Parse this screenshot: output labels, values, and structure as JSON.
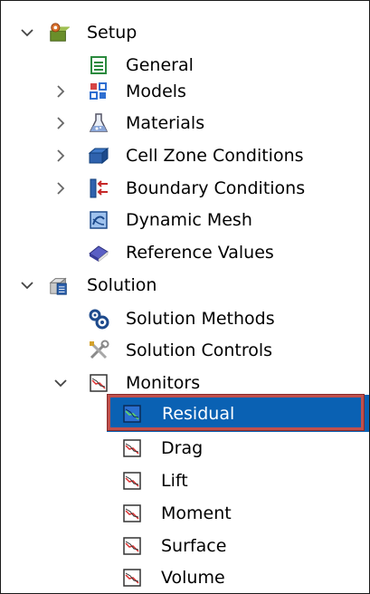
{
  "tree": {
    "setup": {
      "label": "Setup",
      "icon": "setup-icon",
      "expanded": true,
      "children": {
        "general": {
          "label": "General",
          "icon": "general-icon"
        },
        "models": {
          "label": "Models",
          "icon": "models-icon",
          "expandable": true
        },
        "materials": {
          "label": "Materials",
          "icon": "materials-icon",
          "expandable": true
        },
        "cell_zone": {
          "label": "Cell Zone Conditions",
          "icon": "cell-zone-icon",
          "expandable": true
        },
        "boundary": {
          "label": "Boundary Conditions",
          "icon": "boundary-icon",
          "expandable": true
        },
        "dynamic_mesh": {
          "label": "Dynamic Mesh",
          "icon": "dynamic-mesh-icon"
        },
        "reference_values": {
          "label": "Reference Values",
          "icon": "reference-values-icon"
        }
      }
    },
    "solution": {
      "label": "Solution",
      "icon": "solution-icon",
      "expanded": true,
      "children": {
        "methods": {
          "label": "Solution Methods",
          "icon": "solution-methods-icon"
        },
        "controls": {
          "label": "Solution Controls",
          "icon": "solution-controls-icon"
        },
        "monitors": {
          "label": "Monitors",
          "icon": "monitor-icon",
          "expanded": true,
          "children": {
            "residual": {
              "label": "Residual",
              "icon": "monitor-chart-icon",
              "selected": true
            },
            "drag": {
              "label": "Drag",
              "icon": "monitor-chart-icon"
            },
            "lift": {
              "label": "Lift",
              "icon": "monitor-chart-icon"
            },
            "moment": {
              "label": "Moment",
              "icon": "monitor-chart-icon"
            },
            "surface": {
              "label": "Surface",
              "icon": "monitor-chart-icon"
            },
            "volume": {
              "label": "Volume",
              "icon": "monitor-chart-icon"
            }
          }
        }
      }
    }
  },
  "colors": {
    "selection_bg": "#0a61b3",
    "selection_outline": "#c0504d",
    "selection_text": "#ffffff"
  }
}
